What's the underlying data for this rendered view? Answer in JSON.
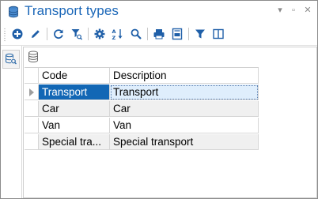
{
  "window": {
    "title": "Transport types",
    "title_color": "#1b67b8",
    "controls": {
      "pin": "▾",
      "minimize": "▫",
      "close": "✕"
    }
  },
  "toolbar": {
    "buttons": [
      {
        "icon": "add-icon"
      },
      {
        "icon": "edit-icon"
      },
      {
        "icon": "refresh-icon"
      },
      {
        "icon": "filter-search-icon"
      },
      {
        "icon": "settings-icon"
      },
      {
        "icon": "sort-az-icon"
      },
      {
        "icon": "search-icon"
      },
      {
        "icon": "print-icon"
      },
      {
        "icon": "print-preview-icon"
      },
      {
        "icon": "filter-icon"
      },
      {
        "icon": "columns-icon"
      }
    ]
  },
  "grid": {
    "columns": [
      "Code",
      "Description"
    ],
    "rows": [
      {
        "code": "Transport",
        "description": "Transport",
        "selected": true
      },
      {
        "code": "Car",
        "description": "Car"
      },
      {
        "code": "Van",
        "description": "Van"
      },
      {
        "code": "Special tra...",
        "description": "Special transport"
      }
    ],
    "selection_color": "#1267b5"
  }
}
